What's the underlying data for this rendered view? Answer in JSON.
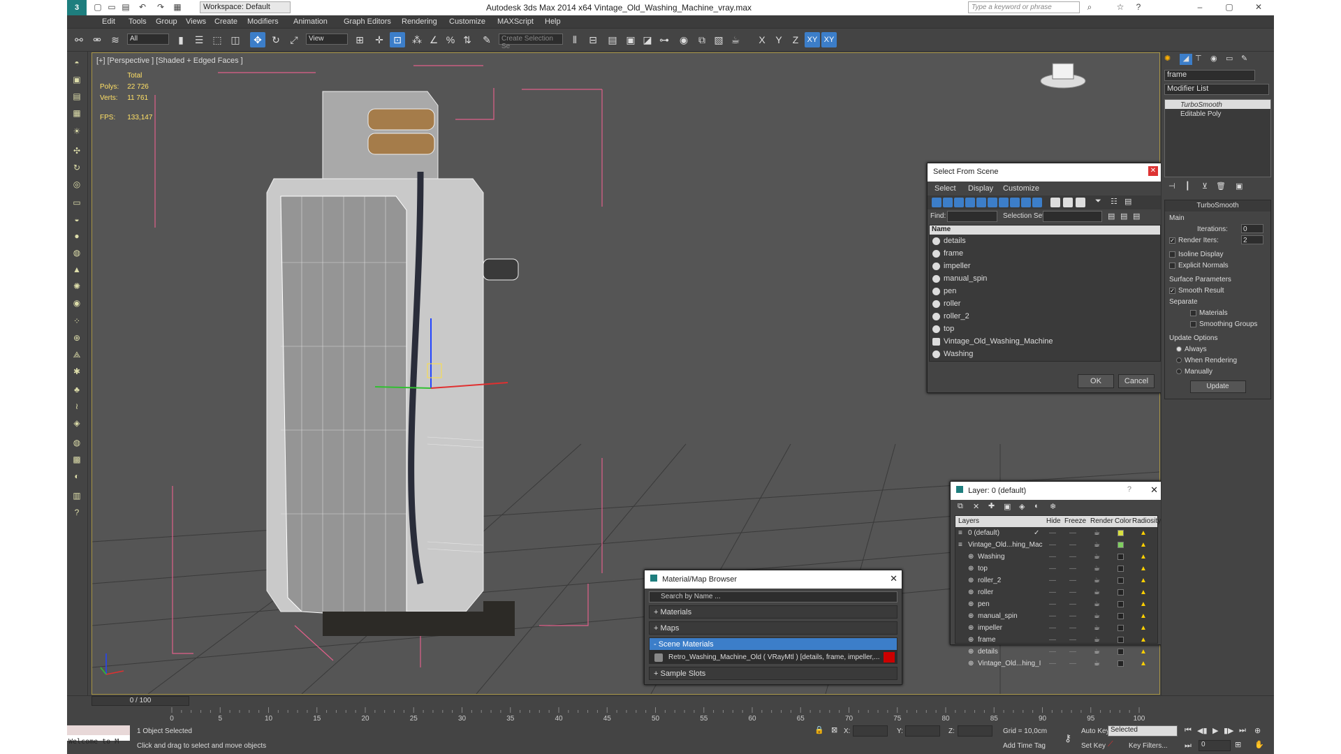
{
  "app": {
    "title": "Autodesk 3ds Max  2014 x64     Vintage_Old_Washing_Machine_vray.max",
    "workspace": "Workspace: Default",
    "search_placeholder": "Type a keyword or phrase"
  },
  "menu": [
    "Edit",
    "Tools",
    "Group",
    "Views",
    "Create",
    "Modifiers",
    "Animation",
    "Graph Editors",
    "Rendering",
    "Customize",
    "MAXScript",
    "Help"
  ],
  "toolbar": {
    "filter": "All",
    "ref_coord": "View",
    "selection_set": "Create Selection Se",
    "axis_x": "X",
    "axis_y": "Y",
    "axis_z": "Z",
    "axis_xy": "XY",
    "axis_xy2": "XY"
  },
  "viewport": {
    "label": "[+] [Perspective ] [Shaded + Edged Faces ]",
    "stats": {
      "total_label": "Total",
      "polys_label": "Polys:",
      "polys": "22 726",
      "verts_label": "Verts:",
      "verts": "11 761",
      "fps_label": "FPS:",
      "fps": "133,147"
    }
  },
  "select_from_scene": {
    "title": "Select From Scene",
    "menus": [
      "Select",
      "Display",
      "Customize"
    ],
    "find_label": "Find:",
    "selection_set_label": "Selection Set:",
    "column": "Name",
    "items": [
      "details",
      "frame",
      "impeller",
      "manual_spin",
      "pen",
      "roller",
      "roller_2",
      "top",
      "Vintage_Old_Washing_Machine",
      "Washing"
    ],
    "ok": "OK",
    "cancel": "Cancel"
  },
  "layer_dialog": {
    "title": "Layer: 0 (default)",
    "columns": [
      "Layers",
      "Hide",
      "Freeze",
      "Render",
      "Color",
      "Radiosity"
    ],
    "rows": [
      {
        "name": "0 (default)",
        "color": "#d8e040"
      },
      {
        "name": "Vintage_Old...hing_Mac",
        "color": "#7fcf5f"
      },
      {
        "name": "Washing",
        "color": "#222222"
      },
      {
        "name": "top",
        "color": "#222222"
      },
      {
        "name": "roller_2",
        "color": "#222222"
      },
      {
        "name": "roller",
        "color": "#222222"
      },
      {
        "name": "pen",
        "color": "#222222"
      },
      {
        "name": "manual_spin",
        "color": "#222222"
      },
      {
        "name": "impeller",
        "color": "#222222"
      },
      {
        "name": "frame",
        "color": "#222222"
      },
      {
        "name": "details",
        "color": "#222222"
      },
      {
        "name": "Vintage_Old...hing_I",
        "color": "#222222"
      }
    ],
    "help": "?"
  },
  "material_browser": {
    "title": "Material/Map Browser",
    "search_placeholder": "Search by Name ...",
    "groups": [
      "+ Materials",
      "+ Maps",
      "- Scene Materials",
      "+ Sample Slots"
    ],
    "scene_material": "Retro_Washing_Machine_Old  ( VRayMtl ) [details, frame, impeller,..."
  },
  "command_panel": {
    "object_name": "frame",
    "modifier_list": "Modifier List",
    "stack": [
      "TurboSmooth",
      "Editable Poly"
    ],
    "rollout_title": "TurboSmooth",
    "main_label": "Main",
    "iterations_label": "Iterations:",
    "iterations": "0",
    "render_iters_label": "Render Iters:",
    "render_iters": "2",
    "isoline": "Isoline Display",
    "explicit_normals": "Explicit Normals",
    "surface_params": "Surface Parameters",
    "smooth_result": "Smooth Result",
    "separate": "Separate",
    "materials": "Materials",
    "smoothing_groups": "Smoothing Groups",
    "update_options": "Update Options",
    "always": "Always",
    "when_rendering": "When Rendering",
    "manually": "Manually",
    "update_btn": "Update"
  },
  "timeline": {
    "frame": "0 / 100",
    "ticks": [
      "0",
      "5",
      "10",
      "15",
      "20",
      "25",
      "30",
      "35",
      "40",
      "45",
      "50",
      "55",
      "60",
      "65",
      "70",
      "75",
      "80",
      "85",
      "90",
      "95",
      "100"
    ]
  },
  "status": {
    "script": "Welcome to M",
    "selected": "1 Object Selected",
    "prompt": "Click and drag to select and move objects",
    "x_label": "X:",
    "y_label": "Y:",
    "z_label": "Z:",
    "grid": "Grid = 10,0cm",
    "add_time_tag": "Add Time Tag",
    "auto_key": "Auto Key",
    "set_key": "Set Key",
    "key_mode": "Selected",
    "key_filters": "Key Filters...",
    "frame_field": "0"
  }
}
